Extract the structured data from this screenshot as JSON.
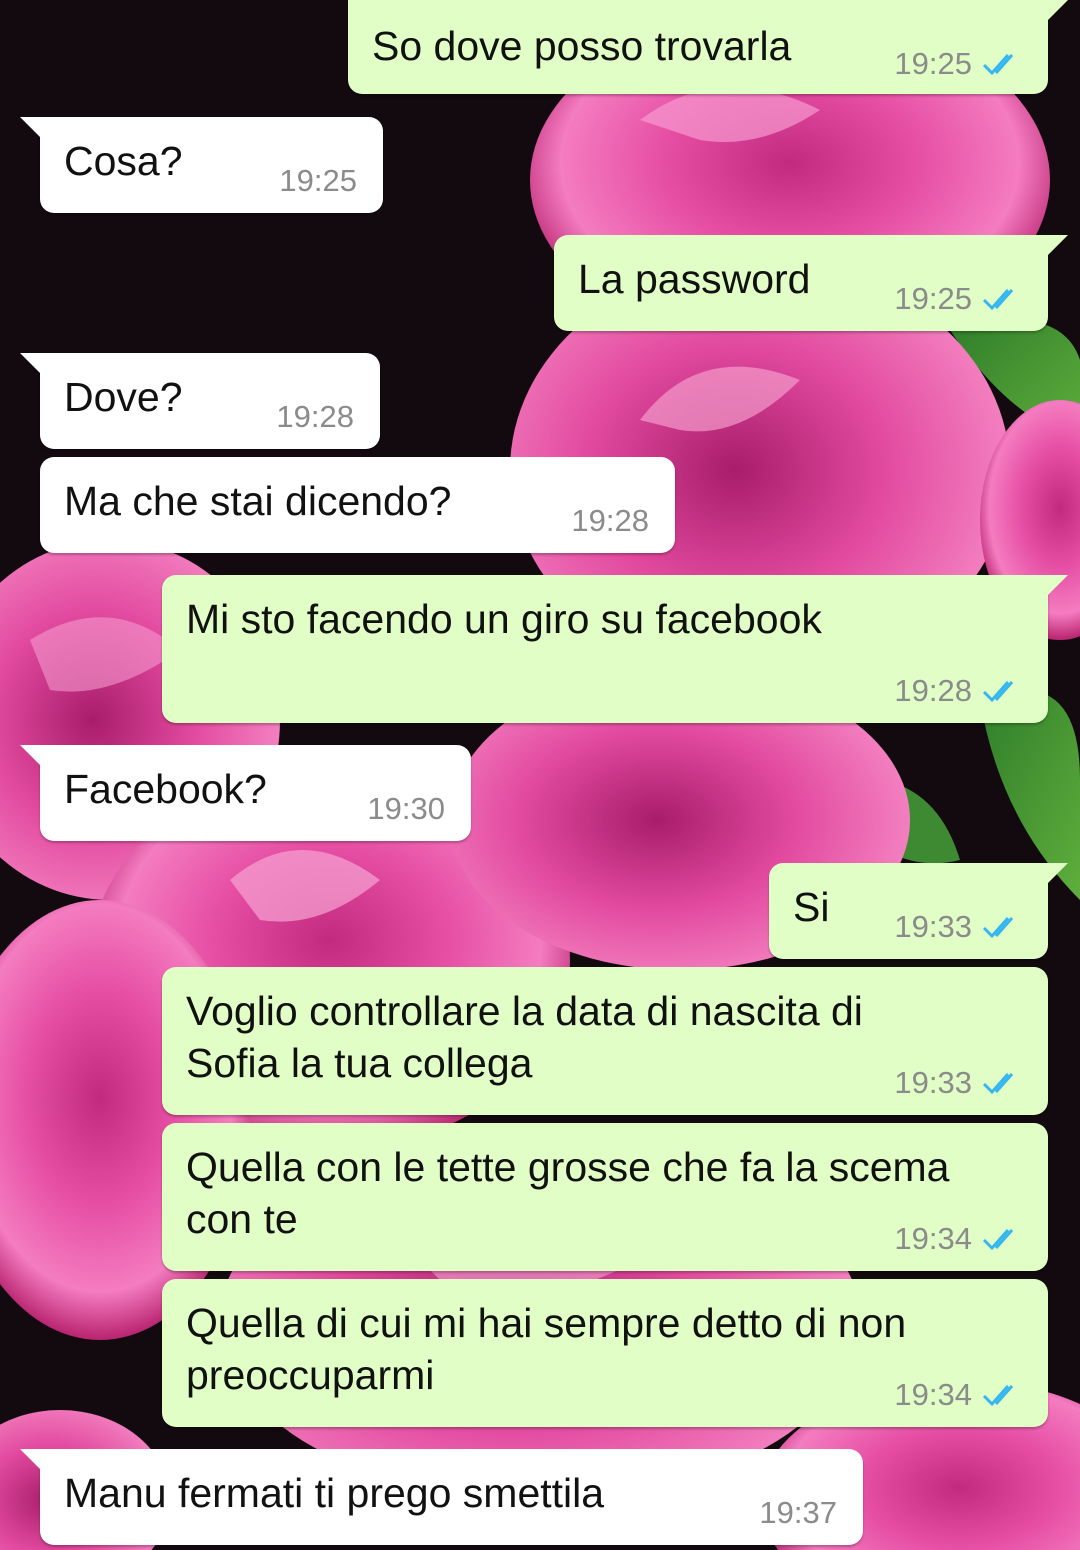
{
  "colors": {
    "incoming_bubble": "#ffffff",
    "outgoing_bubble": "#e1fec6",
    "text": "#111111",
    "timestamp": "#8b8b8b",
    "read_ticks": "#34b7f1"
  },
  "messages": [
    {
      "side": "out",
      "text": "So dove posso trovarla",
      "time": "19:25",
      "status_icon": "double-check-read-icon"
    },
    {
      "side": "in",
      "text": "Cosa?",
      "time": "19:25"
    },
    {
      "side": "out",
      "text": "La password",
      "time": "19:25",
      "status_icon": "double-check-read-icon"
    },
    {
      "side": "in",
      "text": "Dove?",
      "time": "19:28"
    },
    {
      "side": "in",
      "text": "Ma che stai dicendo?",
      "time": "19:28"
    },
    {
      "side": "out",
      "text": "Mi sto facendo un giro su facebook",
      "time": "19:28",
      "status_icon": "double-check-read-icon"
    },
    {
      "side": "in",
      "text": "Facebook?",
      "time": "19:30"
    },
    {
      "side": "out",
      "text": "Si",
      "time": "19:33",
      "status_icon": "double-check-read-icon"
    },
    {
      "side": "out",
      "text": "Voglio controllare la data di nascita di Sofia la tua collega",
      "time": "19:33",
      "status_icon": "double-check-read-icon"
    },
    {
      "side": "out",
      "text": "Quella con le tette grosse che fa la scema con te",
      "time": "19:34",
      "status_icon": "double-check-read-icon"
    },
    {
      "side": "out",
      "text": "Quella di cui mi hai sempre detto di non preoccuparmi",
      "time": "19:34",
      "status_icon": "double-check-read-icon"
    },
    {
      "side": "in",
      "text": "Manu fermati ti prego smettila",
      "time": "19:37"
    }
  ]
}
